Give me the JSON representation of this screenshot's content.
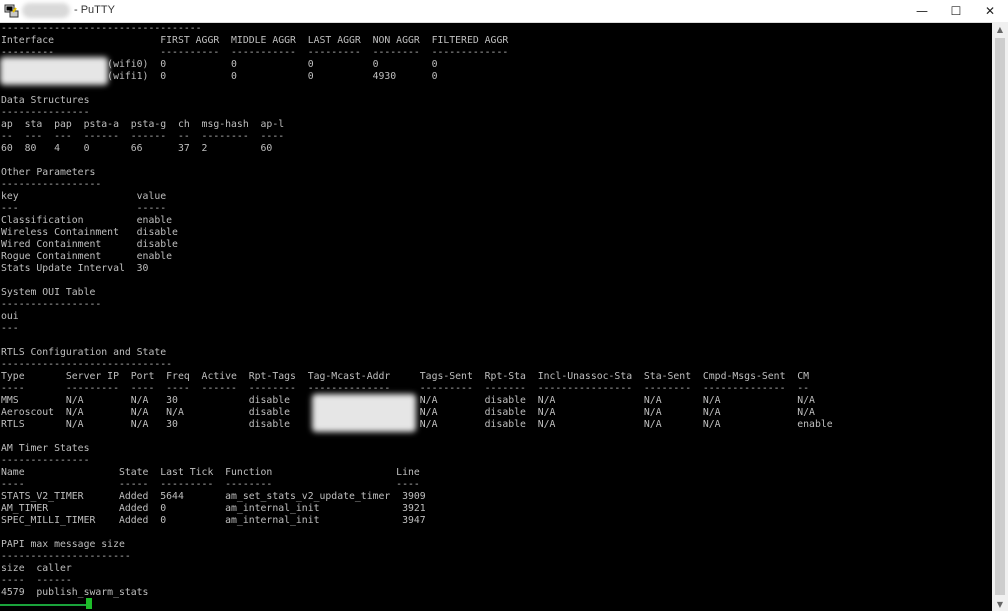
{
  "window": {
    "title": "- PuTTY",
    "minimize_glyph": "—",
    "maximize_glyph": "☐",
    "close_glyph": "✕"
  },
  "icons": {
    "app": "putty-icon",
    "minimize": "minimize-icon",
    "maximize": "maximize-icon",
    "close": "close-icon"
  },
  "colors": {
    "terminal_bg": "#000000",
    "terminal_fg": "#bfbfbf",
    "cursor": "#1ebd2a"
  },
  "terminal": {
    "lines": [
      "----------------------------------",
      "Interface                  FIRST AGGR  MIDDLE AGGR  LAST AGGR  NON AGGR  FILTERED AGGR",
      "---------                  ----------  -----------  ---------  --------  -------------",
      "                  (wifi0)  0           0            0          0         0",
      "                  (wifi1)  0           0            0          4930      0",
      "",
      "Data Structures",
      "---------------",
      "ap  sta  pap  psta-a  psta-g  ch  msg-hash  ap-l",
      "--  ---  ---  ------  ------  --  --------  ----",
      "60  80   4    0       66      37  2         60",
      "",
      "Other Parameters",
      "-----------------",
      "key                    value",
      "---                    -----",
      "Classification         enable",
      "Wireless Containment   disable",
      "Wired Containment      disable",
      "Rogue Containment      enable",
      "Stats Update Interval  30",
      "",
      "System OUI Table",
      "-----------------",
      "oui",
      "---",
      "",
      "RTLS Configuration and State",
      "-----------------------------",
      "Type       Server IP  Port  Freq  Active  Rpt-Tags  Tag-Mcast-Addr     Tags-Sent  Rpt-Sta  Incl-Unassoc-Sta  Sta-Sent  Cmpd-Msgs-Sent  CM",
      "----       ---------  ----  ----  ------  --------  --------------     ---------  -------  ----------------  --------  --------------  --",
      "MMS        N/A        N/A   30            disable                      N/A        disable  N/A               N/A       N/A             N/A",
      "Aeroscout  N/A        N/A   N/A           disable                      N/A        disable  N/A               N/A       N/A             N/A",
      "RTLS       N/A        N/A   30            disable                      N/A        disable  N/A               N/A       N/A             enable",
      "",
      "AM Timer States",
      "---------------",
      "Name                State  Last Tick  Function                     Line",
      "----                -----  ---------  --------                     ----",
      "STATS_V2_TIMER      Added  5644       am_set_stats_v2_update_timer  3909",
      "AM_TIMER            Added  0          am_internal_init              3921",
      "SPEC_MILLI_TIMER    Added  0          am_internal_init              3947",
      "",
      "PAPI max message size",
      "----------------------",
      "size  caller",
      "----  ------",
      "4579  publish_swarm_stats"
    ]
  }
}
